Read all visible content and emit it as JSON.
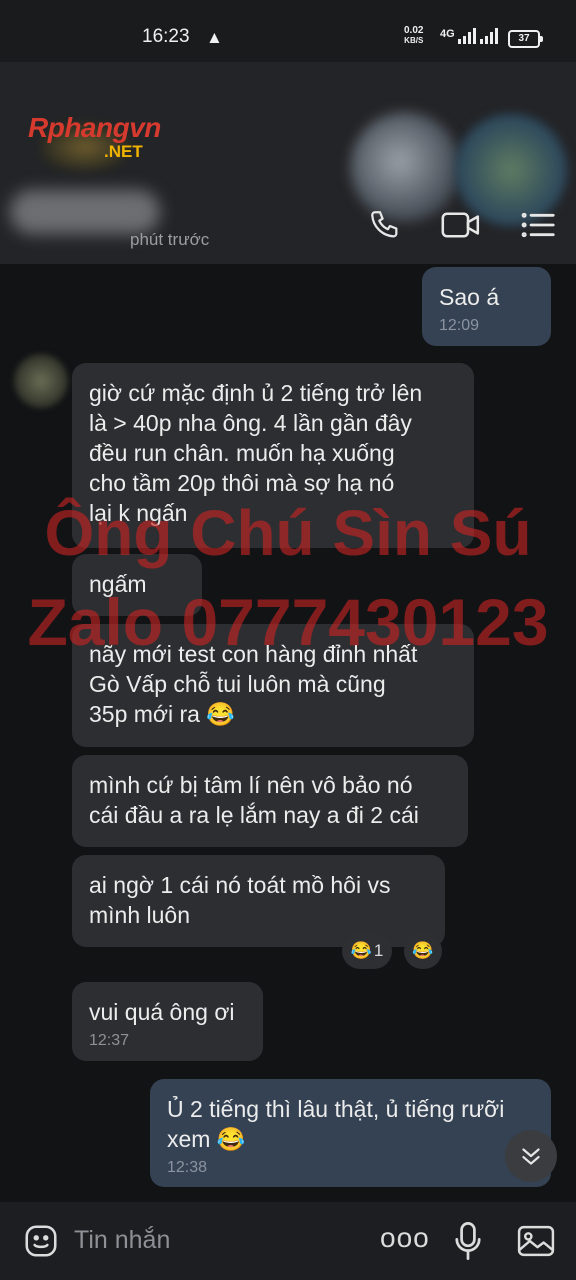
{
  "status_bar": {
    "time": "16:23",
    "net_speed": "0.02",
    "net_unit": "KB/S",
    "network": "4G",
    "battery": "37"
  },
  "header": {
    "logo_main": "Rphangvn",
    "logo_sub": ".NET",
    "subtitle": "phút trước"
  },
  "messages": [
    {
      "side": "me",
      "text": "Sao á",
      "time": "12:09"
    },
    {
      "side": "in",
      "text": "giờ cứ mặc định ủ 2 tiếng trở lên\nlà > 40p nha ông. 4 lần gần đây\nđều run chân. muốn hạ xuống\ncho tầm 20p thôi mà sợ hạ nó\nlại k ngấn"
    },
    {
      "side": "in",
      "text": "ngấm"
    },
    {
      "side": "in",
      "text": "nãy mới test con hàng đỉnh nhất\nGò Vấp chỗ tui luôn mà cũng\n35p mới ra 😂"
    },
    {
      "side": "in",
      "text": "mình cứ bị tâm lí nên vô bảo nó\ncái đầu a ra lẹ lắm nay a đi 2 cái"
    },
    {
      "side": "in",
      "text": "ai ngờ 1 cái nó toát mồ hôi vs\nmình luôn"
    },
    {
      "side": "in",
      "text": "vui quá ông ơi",
      "time": "12:37"
    },
    {
      "side": "me",
      "text": "Ủ 2 tiếng thì lâu thật, ủ tiếng rưỡi\nxem 😂",
      "time": "12:38"
    }
  ],
  "reactions": {
    "count_emoji": "😂",
    "count": "1",
    "quick_emoji": "😂"
  },
  "watermark": {
    "line1": "Ông Chú Sìn Sú",
    "line2": "Zalo 0777430123"
  },
  "input": {
    "placeholder": "Tin nhắn",
    "more_label": "ooo"
  },
  "icons": [
    "phone-icon",
    "video-call-icon",
    "menu-icon",
    "sticker-icon",
    "more-icon",
    "microphone-icon",
    "image-icon",
    "scroll-down-icon",
    "warning-icon"
  ],
  "colors": {
    "background": "#121315",
    "incoming_bubble": "#2d2e31",
    "outgoing_bubble": "#344253",
    "watermark": "#c82323"
  }
}
